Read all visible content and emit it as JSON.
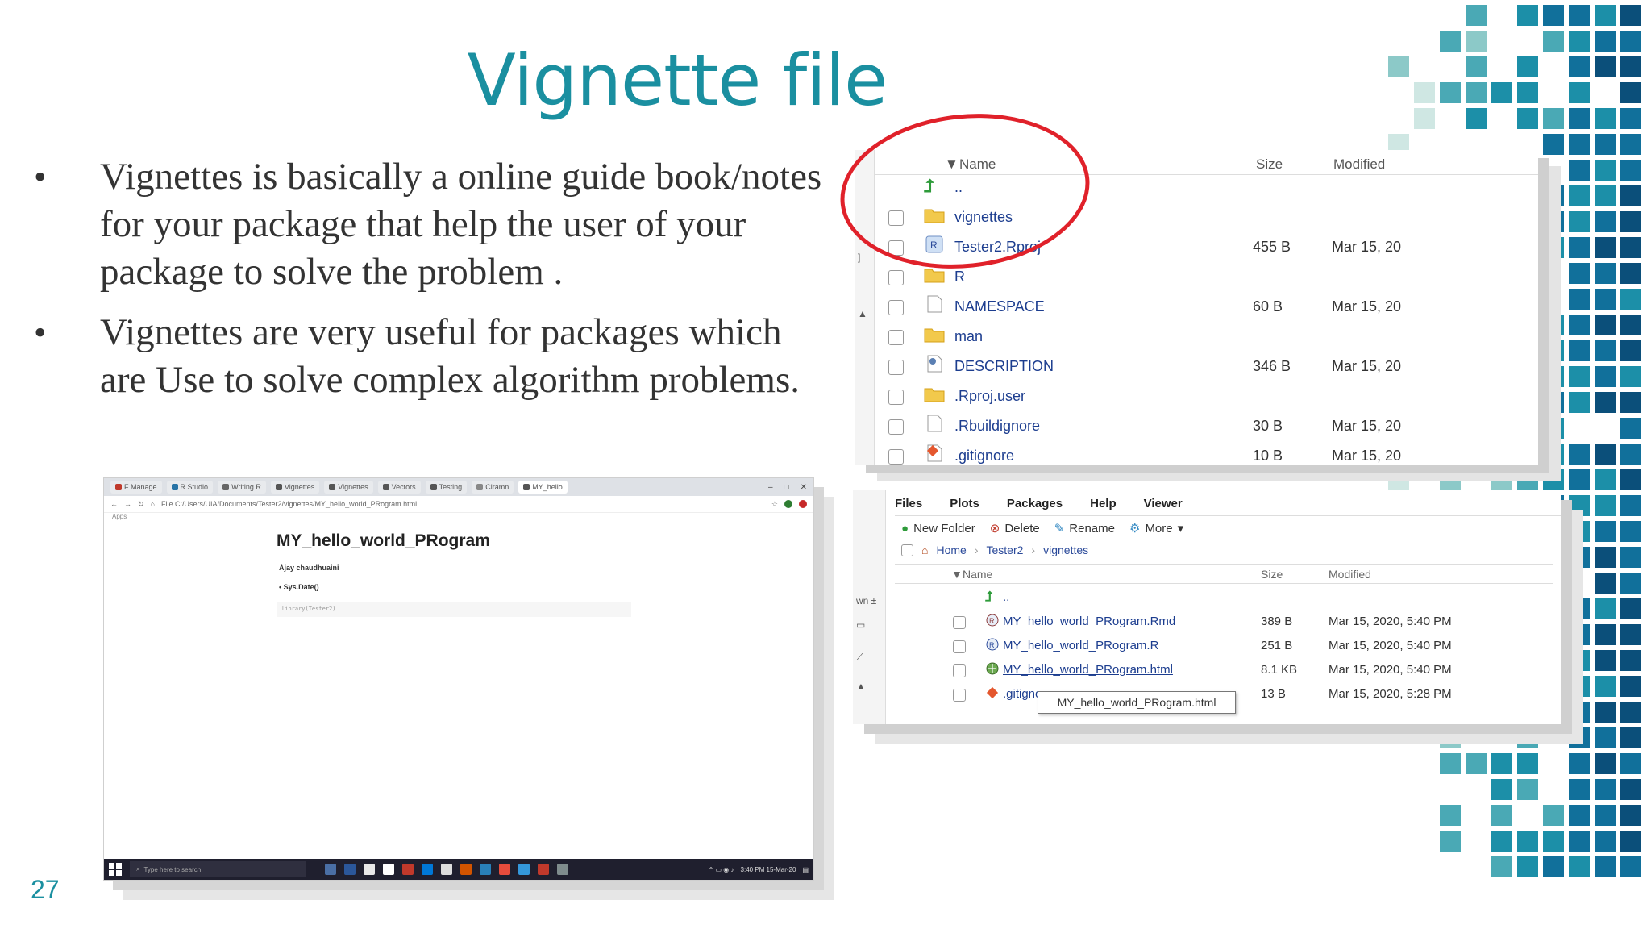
{
  "slide": {
    "title": "Vignette file",
    "bullets": [
      "Vignettes is basically a online guide book/notes for your package that help the user of  your package to solve the problem .",
      "Vignettes are very useful for packages which are Use to solve complex algorithm problems."
    ],
    "page_number": "27",
    "accent_color": "#1a8fa0"
  },
  "browser": {
    "tabs": [
      "F Manage",
      "R Studio",
      "Writing R",
      "Vignettes",
      "Vignettes",
      "Vectors",
      "Testing",
      "Ciramn",
      "MY_hello"
    ],
    "url": "File  C:/Users/UIA/Documents/Tester2/vignettes/MY_hello_world_PRogram.html",
    "apps_label": "Apps",
    "doc_title": "MY_hello_world_PRogram",
    "doc_author": "Ajay chaudhuaini",
    "doc_date": "• Sys.Date()",
    "doc_code": "library(Tester2)",
    "taskbar_search": "Type here to search",
    "taskbar_time": "3:40 PM  15-Mar-20"
  },
  "files_top": {
    "columns": {
      "name": "Name",
      "size": "Size",
      "modified": "Modified"
    },
    "rows": [
      {
        "name": "..",
        "size": "",
        "modified": "",
        "icon": "up-arrow-icon"
      },
      {
        "name": "vignettes",
        "size": "",
        "modified": "",
        "icon": "folder-icon"
      },
      {
        "name": "Tester2.Rproj",
        "size": "455 B",
        "modified": "Mar 15, 20",
        "icon": "rproj-icon"
      },
      {
        "name": "R",
        "size": "",
        "modified": "",
        "icon": "folder-icon"
      },
      {
        "name": "NAMESPACE",
        "size": "60 B",
        "modified": "Mar 15, 20",
        "icon": "file-icon"
      },
      {
        "name": "man",
        "size": "",
        "modified": "",
        "icon": "folder-icon"
      },
      {
        "name": "DESCRIPTION",
        "size": "346 B",
        "modified": "Mar 15, 20",
        "icon": "gear-file-icon"
      },
      {
        "name": ".Rproj.user",
        "size": "",
        "modified": "",
        "icon": "folder-icon"
      },
      {
        "name": ".Rbuildignore",
        "size": "30 B",
        "modified": "Mar 15, 20",
        "icon": "file-icon"
      },
      {
        "name": ".gitignore",
        "size": "10 B",
        "modified": "Mar 15, 20",
        "icon": "git-icon"
      }
    ]
  },
  "files_bottom": {
    "tabs": [
      "Files",
      "Plots",
      "Packages",
      "Help",
      "Viewer"
    ],
    "tools": [
      "New Folder",
      "Delete",
      "Rename",
      "More"
    ],
    "breadcrumb": [
      "Home",
      "Tester2",
      "vignettes"
    ],
    "columns": {
      "name": "Name",
      "size": "Size",
      "modified": "Modified"
    },
    "rows": [
      {
        "name": "..",
        "size": "",
        "modified": ""
      },
      {
        "name": "MY_hello_world_PRogram.Rmd",
        "size": "389 B",
        "modified": "Mar 15, 2020, 5:40 PM"
      },
      {
        "name": "MY_hello_world_PRogram.R",
        "size": "251 B",
        "modified": "Mar 15, 2020, 5:40 PM"
      },
      {
        "name": "MY_hello_world_PRogram.html",
        "size": "8.1 KB",
        "modified": "Mar 15, 2020, 5:40 PM"
      },
      {
        "name": ".gitignore",
        "size": "13 B",
        "modified": "Mar 15, 2020, 5:28 PM"
      }
    ],
    "tooltip": "MY_hello_world_PRogram.html",
    "left_labels": [
      "wn ±"
    ]
  }
}
